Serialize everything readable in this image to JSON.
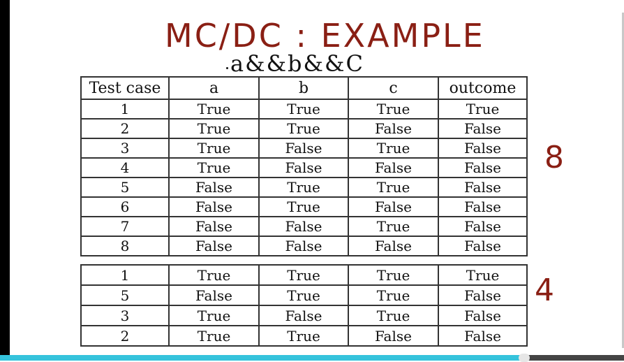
{
  "title": "MC/DC : EXAMPLE",
  "expression": "a&&b&&C",
  "table_all": {
    "headers": [
      "Test case",
      "a",
      "b",
      "c",
      "outcome"
    ],
    "rows": [
      [
        "1",
        "True",
        "True",
        "True",
        "True"
      ],
      [
        "2",
        "True",
        "True",
        "False",
        "False"
      ],
      [
        "3",
        "True",
        "False",
        "True",
        "False"
      ],
      [
        "4",
        "True",
        "False",
        "False",
        "False"
      ],
      [
        "5",
        "False",
        "True",
        "True",
        "False"
      ],
      [
        "6",
        "False",
        "True",
        "False",
        "False"
      ],
      [
        "7",
        "False",
        "False",
        "True",
        "False"
      ],
      [
        "8",
        "False",
        "False",
        "False",
        "False"
      ]
    ],
    "count": "8"
  },
  "table_min": {
    "rows": [
      [
        "1",
        "True",
        "True",
        "True",
        "True"
      ],
      [
        "5",
        "False",
        "True",
        "True",
        "False"
      ],
      [
        "3",
        "True",
        "False",
        "True",
        "False"
      ],
      [
        "2",
        "True",
        "True",
        "False",
        "False"
      ]
    ],
    "count": "4"
  },
  "video_progress": 0.84,
  "colors": {
    "title": "#8a1f14",
    "count": "#8a1f14",
    "progress": "#35c3dc"
  }
}
